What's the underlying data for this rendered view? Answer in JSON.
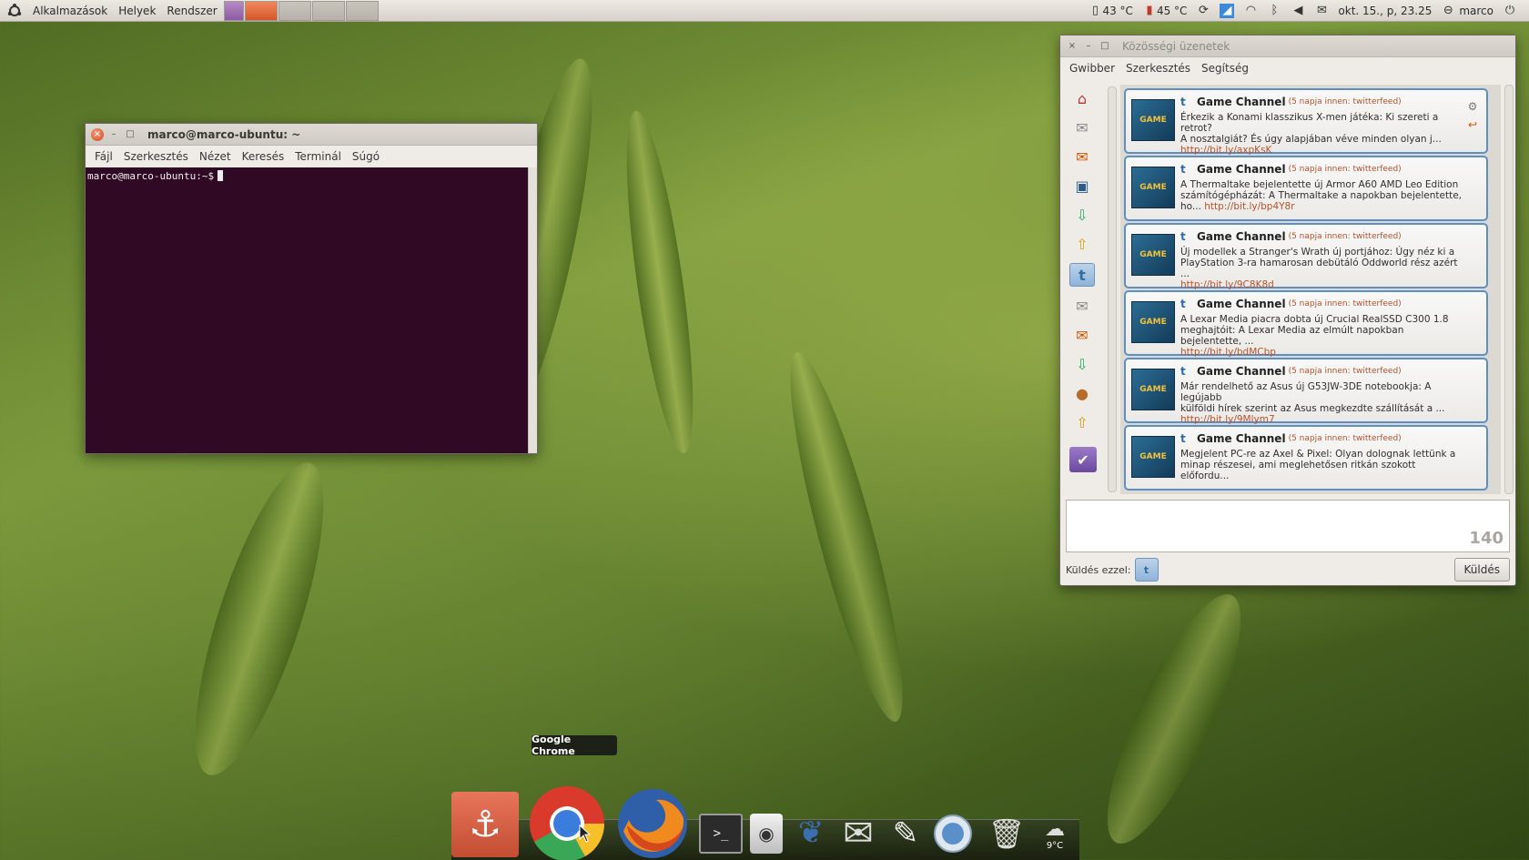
{
  "top_panel": {
    "menus": [
      "Alkalmazások",
      "Helyek",
      "Rendszer"
    ],
    "tray": {
      "cpu_temp": "43 °C",
      "gpu_temp": "45 °C",
      "datetime": "okt. 15., p, 23.25",
      "user": "marco"
    },
    "icons": [
      "ubuntu-logo-icon",
      "cpu-temp-icon",
      "gpu-temp-icon",
      "sync-icon",
      "network-icon",
      "wifi-icon",
      "bluetooth-icon",
      "volume-icon",
      "mail-icon",
      "user-status-icon",
      "power-icon"
    ]
  },
  "terminal": {
    "title": "marco@marco-ubuntu: ~",
    "menu": [
      "Fájl",
      "Szerkesztés",
      "Nézet",
      "Keresés",
      "Terminál",
      "Súgó"
    ],
    "prompt": "marco@marco-ubuntu:~$"
  },
  "gwibber": {
    "title": "Közösségi üzenetek",
    "menu": [
      "Gwibber",
      "Szerkesztés",
      "Segítség"
    ],
    "messages": [
      {
        "sender": "Game Channel",
        "meta": "(5 napja innen: twitterfeed)",
        "body": "Érkezik a Konami klasszikus X-men játéka: Ki szereti a retrot?\nA nosztalgiát? És úgy alapjában véve minden olyan j...",
        "link": "http://bit.ly/axpKsK"
      },
      {
        "sender": "Game Channel",
        "meta": "(5 napja innen: twitterfeed)",
        "body": "A Thermaltake bejelentette új Armor A60 AMD Leo Edition\nszámítógépházát: A Thermaltake a napokban bejelentette,\nho...",
        "link": "http://bit.ly/bp4Y8r"
      },
      {
        "sender": "Game Channel",
        "meta": "(5 napja innen: twitterfeed)",
        "body": "Új modellek a Stranger's Wrath új portjához: Úgy néz ki a\nPlayStation 3-ra hamarosan debütáló Oddworld rész azért ...",
        "link": "http://bit.ly/9C8K8d"
      },
      {
        "sender": "Game Channel",
        "meta": "(5 napja innen: twitterfeed)",
        "body": "A Lexar Media piacra dobta új Crucial RealSSD C300 1.8\nmeghajtóit: A Lexar Media az elmúlt napokban bejelentette, ...",
        "link": "http://bit.ly/bdMCbp"
      },
      {
        "sender": "Game Channel",
        "meta": "(5 napja innen: twitterfeed)",
        "body": "Már rendelhető az Asus új G53JW-3DE notebookja: A legújabb\nkülföldi hírek szerint az Asus megkezdte szállítását a ...",
        "link": "http://bit.ly/9Mlym7"
      },
      {
        "sender": "Game Channel",
        "meta": "(5 napja innen: twitterfeed)",
        "body": "Megjelent PC-re az Axel & Pixel: Olyan dolognak lettünk a\nminap részesei, ami meglehetősen ritkán szokott előfordu...",
        "link": ""
      }
    ],
    "char_count": "140",
    "send_with_label": "Küldés ezzel:",
    "send_button": "Küldés"
  },
  "dock": {
    "tooltip": "Google Chrome",
    "weather": "9°C",
    "items": [
      "anchor-icon",
      "chrome-icon",
      "firefox-icon",
      "terminal-icon",
      "speaker-icon",
      "pidgin-icon",
      "mail-icon",
      "text-editor-icon",
      "web-browser-icon",
      "trash-icon",
      "weather-icon"
    ]
  }
}
